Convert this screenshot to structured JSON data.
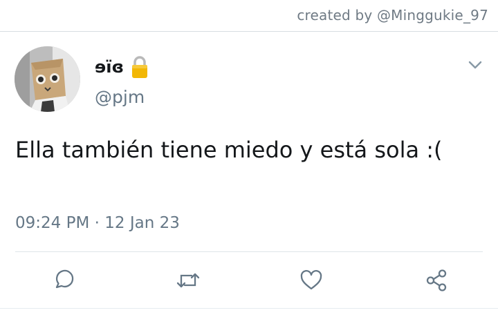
{
  "watermark": "created by @Minggukie_97",
  "tweet": {
    "display_name": "ɘïɞ",
    "handle": "@pjm",
    "text": "Ella también tiene miedo y está sola :(",
    "time": "09:24 PM",
    "separator": " · ",
    "date": "12 Jan 23"
  },
  "icons": {
    "lock": "lock-icon",
    "menu": "chevron-down-icon",
    "reply": "reply-icon",
    "retweet": "retweet-icon",
    "like": "heart-icon",
    "share": "share-icon"
  },
  "colors": {
    "text": "#14171a",
    "secondary": "#657786",
    "divider": "#dfe4e8",
    "lock": "#f2b705"
  }
}
